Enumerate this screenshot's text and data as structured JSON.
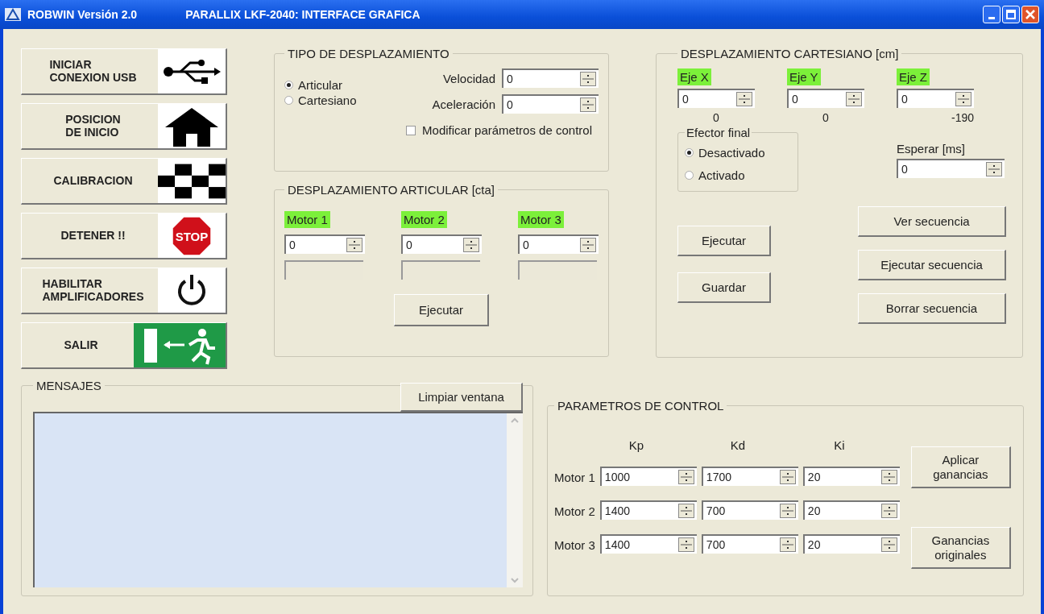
{
  "window": {
    "app_title": "ROBWIN  Versión 2.0",
    "title": "PARALLIX LKF-2040: INTERFACE GRAFICA"
  },
  "sidebar_buttons": [
    {
      "label": "INICIAR\nCONEXION USB",
      "kind": "usb"
    },
    {
      "label": "POSICION\nDE INICIO",
      "kind": "home"
    },
    {
      "label": "CALIBRACION",
      "kind": "checkered"
    },
    {
      "label": "DETENER !!",
      "kind": "stop",
      "icon_text": "STOP"
    },
    {
      "label": "HABILITAR\nAMPLIFICADORES",
      "kind": "power"
    },
    {
      "label": "SALIR",
      "kind": "exit"
    }
  ],
  "tipo_desplazamiento": {
    "title": "TIPO DE DESPLAZAMIENTO",
    "radios": [
      {
        "label": "Articular",
        "selected": true
      },
      {
        "label": "Cartesiano",
        "selected": false
      }
    ],
    "fields": [
      {
        "label": "Velocidad",
        "value": "0"
      },
      {
        "label": "Aceleración",
        "value": "0"
      }
    ],
    "checkbox": {
      "label": "Modificar parámetros de control",
      "checked": false
    }
  },
  "desplazamiento_articular": {
    "title": "DESPLAZAMIENTO ARTICULAR [cta]",
    "motors": [
      {
        "label": "Motor 1",
        "value": "0"
      },
      {
        "label": "Motor 2",
        "value": "0"
      },
      {
        "label": "Motor 3",
        "value": "0"
      }
    ],
    "button": "Ejecutar"
  },
  "desplazamiento_cartesiano": {
    "title": "DESPLAZAMIENTO CARTESIANO [cm]",
    "axes": [
      {
        "label": "Eje X",
        "value": "0",
        "reading": "0"
      },
      {
        "label": "Eje Y",
        "value": "0",
        "reading": "0"
      },
      {
        "label": "Eje Z",
        "value": "0",
        "reading": "-190"
      }
    ],
    "efector": {
      "title": "Efector final",
      "radios": [
        {
          "label": "Desactivado",
          "selected": true
        },
        {
          "label": "Activado",
          "selected": false
        }
      ]
    },
    "esperar": {
      "label": "Esperar [ms]",
      "value": "0"
    },
    "left_buttons": [
      "Ejecutar",
      "Guardar"
    ],
    "right_buttons": [
      "Ver secuencia",
      "Ejecutar secuencia",
      "Borrar secuencia"
    ]
  },
  "mensajes": {
    "title": "MENSAJES",
    "button": "Limpiar ventana"
  },
  "parametros": {
    "title": "PARAMETROS DE CONTROL",
    "columns": [
      "Kp",
      "Kd",
      "Ki"
    ],
    "rows": [
      {
        "label": "Motor 1",
        "values": [
          "1000",
          "1700",
          "20"
        ]
      },
      {
        "label": "Motor 2",
        "values": [
          "1400",
          "700",
          "20"
        ]
      },
      {
        "label": "Motor 3",
        "values": [
          "1400",
          "700",
          "20"
        ]
      }
    ],
    "buttons": [
      "Aplicar\nganancias",
      "Ganancias\noriginales"
    ]
  }
}
